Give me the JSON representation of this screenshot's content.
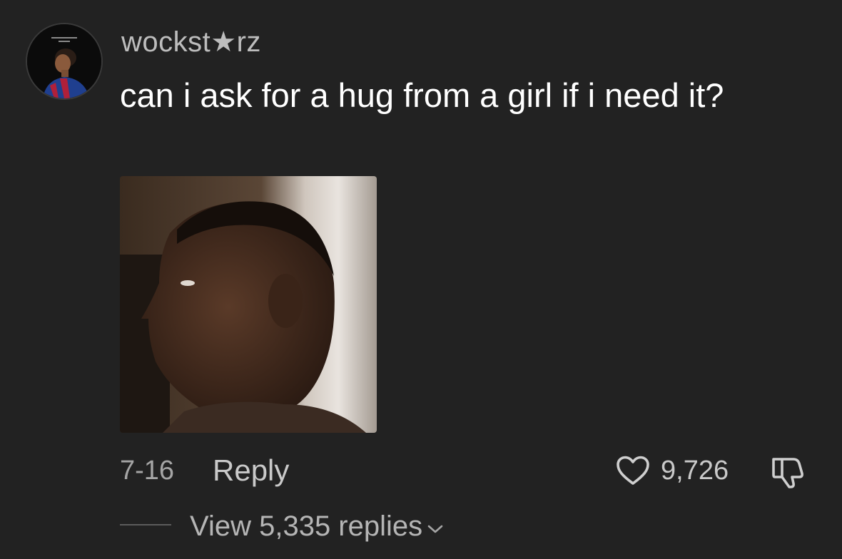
{
  "comment": {
    "username": "wockst★rz",
    "text": "can i ask for a hug from a girl if i need it?",
    "avatar_icon": "profile-photo-icon",
    "sticker_icon": "reaction-gif-image",
    "date": "7-16",
    "reply_label": "Reply",
    "like_count": "9,726",
    "like_icon": "heart-outline-icon",
    "dislike_icon": "thumbs-down-icon",
    "view_replies_label": "View 5,335 replies",
    "chevron_icon": "chevron-down-icon"
  },
  "theme": {
    "background": "#222222",
    "text_primary": "#ffffff",
    "text_secondary": "#a5a5a5"
  }
}
